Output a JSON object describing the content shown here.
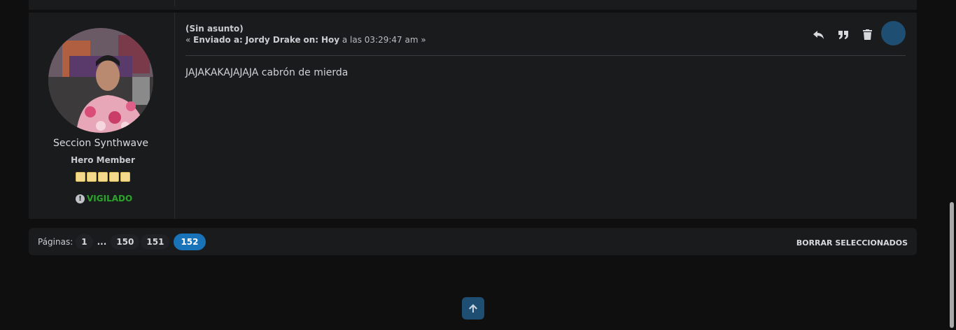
{
  "post": {
    "poster": {
      "name": "Seccion Synthwave",
      "rank": "Hero Member",
      "stars": 5,
      "status": "VIGILADO",
      "status_icon_glyph": "!",
      "status_color": "#2aa52a"
    },
    "subject": "(Sin asunto)",
    "sent": {
      "prefix": "«",
      "label": "Enviado a:",
      "recipient": "Jordy Drake",
      "on_label": "on:",
      "day": "Hoy",
      "time_text": "a las 03:29:47 am",
      "suffix": "»"
    },
    "actions": [
      "reply-icon",
      "quote-icon",
      "trash-icon"
    ],
    "message": "JAJAKAKAJAJAJA cabrón de mierda"
  },
  "pagination": {
    "label": "Páginas:",
    "pages": [
      "1",
      "...",
      "150",
      "151"
    ],
    "current": "152",
    "current_color": "#1973b8"
  },
  "delete_selected_label": "BORRAR SELECCIONADOS",
  "back_to_top_icon": "arrow-up-icon",
  "colors": {
    "background": "#0f0f10",
    "panel": "#1a1b1d",
    "accent": "#1e4e72"
  }
}
